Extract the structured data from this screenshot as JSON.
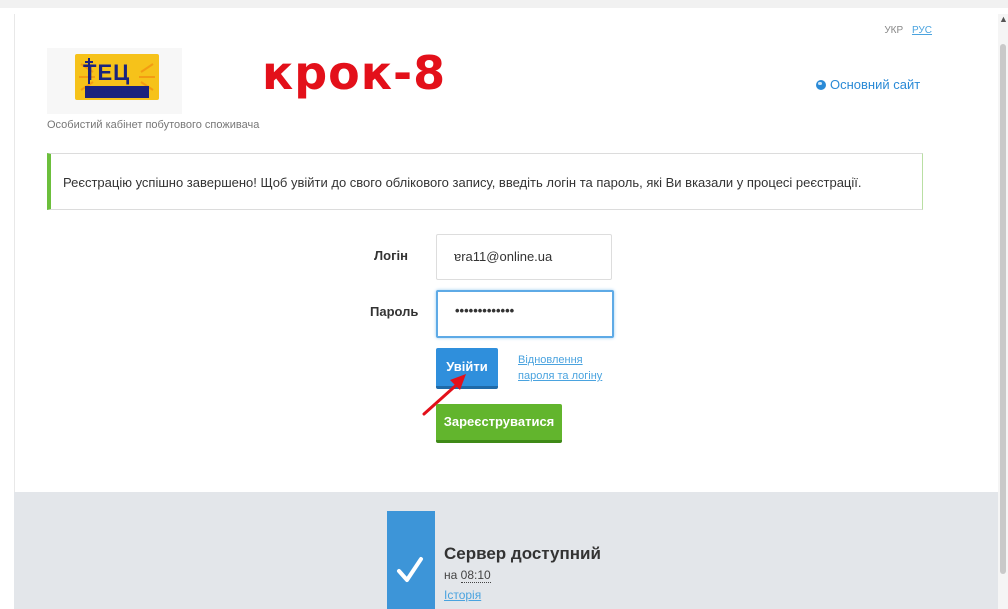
{
  "lang": {
    "ukr": "УКР",
    "rus": "РУС"
  },
  "logo": {
    "name": "ТЕЦ",
    "sub": "ДНІПРОВСЬКА"
  },
  "subtitle": "Особистий кабінет побутового споживача",
  "annotation": {
    "step": "крок-8"
  },
  "main_site": "Основний сайт",
  "alert": {
    "message": "Реєстрацію успішно завершено! Щоб увійти до свого облікового запису, введіть логін та пароль, які Ви вказали у процесі реєстрації."
  },
  "form": {
    "login_label": "Логін",
    "login_value": "ɐra11@online.ua",
    "password_label": "Пароль",
    "password_value": "•••••••••••••",
    "login_button": "Увійти",
    "recover_line1": "Відновлення",
    "recover_line2": "пароля та логіну",
    "register_button": "Зареєструватися"
  },
  "server": {
    "title": "Сервер доступний",
    "time_prefix": "на",
    "time": "08:10",
    "history": "Історія"
  },
  "colors": {
    "accent": "#2f8fdc",
    "success": "#62b52d",
    "annotation": "#e3101a"
  }
}
